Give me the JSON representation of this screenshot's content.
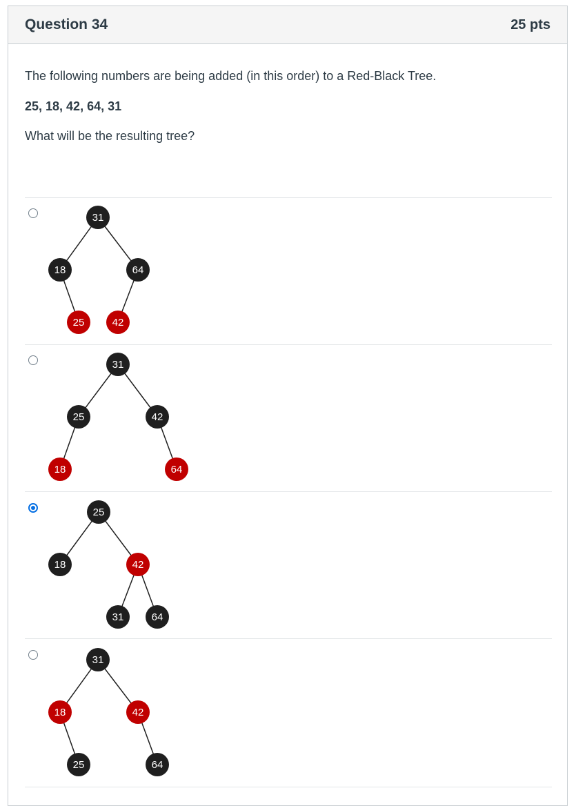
{
  "question": {
    "title": "Question 34",
    "points": "25 pts",
    "prompt": "The following numbers are being added (in this order) to a Red-Black Tree.",
    "sequence": "25, 18, 42, 64, 31",
    "ask": "What will be the resulting tree?"
  },
  "colors": {
    "black_node": "#1f1f1f",
    "red_node": "#c00000",
    "selected": "#0770e3"
  },
  "answers": [
    {
      "selected": false,
      "nodes": [
        {
          "label": "31",
          "color": "black"
        },
        {
          "label": "18",
          "color": "black"
        },
        {
          "label": "64",
          "color": "black"
        },
        {
          "label": "25",
          "color": "red"
        },
        {
          "label": "42",
          "color": "red"
        }
      ]
    },
    {
      "selected": false,
      "nodes": [
        {
          "label": "31",
          "color": "black"
        },
        {
          "label": "25",
          "color": "black"
        },
        {
          "label": "42",
          "color": "black"
        },
        {
          "label": "18",
          "color": "red"
        },
        {
          "label": "64",
          "color": "red"
        }
      ]
    },
    {
      "selected": true,
      "nodes": [
        {
          "label": "25",
          "color": "black"
        },
        {
          "label": "18",
          "color": "black"
        },
        {
          "label": "42",
          "color": "red"
        },
        {
          "label": "31",
          "color": "black"
        },
        {
          "label": "64",
          "color": "black"
        }
      ]
    },
    {
      "selected": false,
      "nodes": [
        {
          "label": "31",
          "color": "black"
        },
        {
          "label": "18",
          "color": "red"
        },
        {
          "label": "42",
          "color": "red"
        },
        {
          "label": "25",
          "color": "black"
        },
        {
          "label": "64",
          "color": "black"
        }
      ]
    }
  ]
}
